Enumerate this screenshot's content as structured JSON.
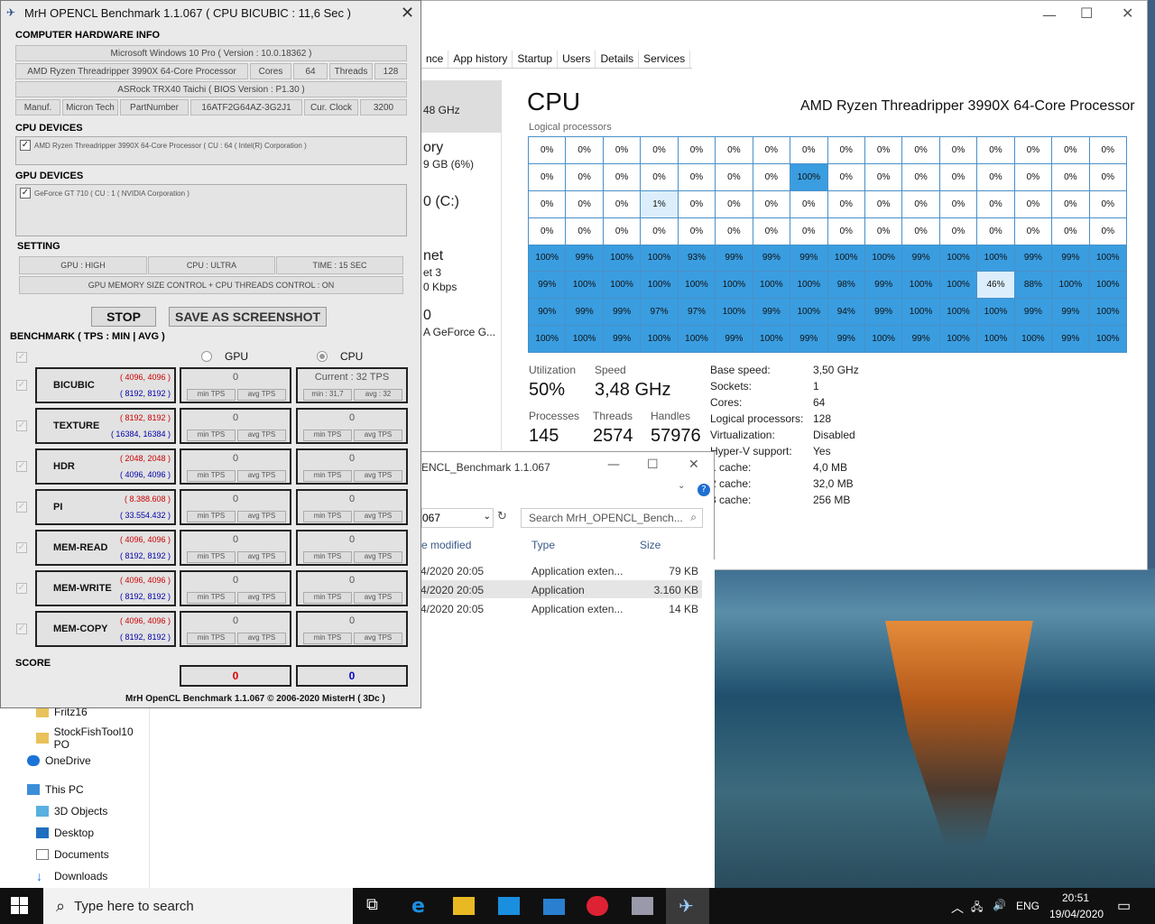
{
  "bench": {
    "title": "MrH OPENCL Benchmark 1.1.067 ( CPU BICUBIC : 11,6 Sec )",
    "hw_section": "COMPUTER HARDWARE INFO",
    "os": "Microsoft Windows 10 Pro ( Version : 10.0.18362 )",
    "cpu_name": "AMD Ryzen Threadripper 3990X 64-Core Processor",
    "cores_label": "Cores",
    "cores": "64",
    "threads_label": "Threads",
    "threads": "128",
    "board": "ASRock TRX40 Taichi ( BIOS Version : P1.30 )",
    "manuf_label": "Manuf.",
    "manuf": "Micron Tech",
    "part_label": "PartNumber",
    "part": "16ATF2G64AZ-3G2J1",
    "clock_label": "Cur. Clock",
    "clock": "3200",
    "cpu_devices": "CPU DEVICES",
    "cpu_device": "AMD Ryzen Threadripper 3990X 64-Core Processor   ( CU : 64  ( Intel(R) Corporation )",
    "gpu_devices": "GPU DEVICES",
    "gpu_device": "GeForce GT 710 ( CU : 1  ( NVIDIA Corporation )",
    "setting": "SETTING",
    "gpu_setting": "GPU : HIGH",
    "cpu_setting": "CPU : ULTRA",
    "time_setting": "TIME : 15 SEC",
    "memory_setting": "GPU MEMORY SIZE CONTROL + CPU THREADS CONTROL : ON",
    "stop": "STOP",
    "screenshot": "SAVE AS SCREENSHOT",
    "benchmark_label": "BENCHMARK ( TPS : MIN | AVG )",
    "gpu_col": "GPU",
    "cpu_col": "CPU",
    "min_tps": "min TPS",
    "avg_tps": "avg TPS",
    "rows": [
      {
        "name": "BICUBIC",
        "red": "( 4096, 4096 )",
        "blue": "( 8192, 8192 )",
        "gpu": "0",
        "cpu": "Current : 32 TPS",
        "cpu_min": "min : 31,7",
        "cpu_avg": "avg : 32"
      },
      {
        "name": "TEXTURE",
        "red": "( 8192, 8192 )",
        "blue": "( 16384, 16384 )",
        "gpu": "0",
        "cpu": "0",
        "cpu_min": "min TPS",
        "cpu_avg": "avg TPS"
      },
      {
        "name": "HDR",
        "red": "( 2048, 2048 )",
        "blue": "( 4096, 4096 )",
        "gpu": "0",
        "cpu": "0",
        "cpu_min": "min TPS",
        "cpu_avg": "avg TPS"
      },
      {
        "name": "PI",
        "red": "( 8.388.608 )",
        "blue": "( 33.554.432 )",
        "gpu": "0",
        "cpu": "0",
        "cpu_min": "min TPS",
        "cpu_avg": "avg TPS"
      },
      {
        "name": "MEM-READ",
        "red": "( 4096, 4096 )",
        "blue": "( 8192, 8192 )",
        "gpu": "0",
        "cpu": "0",
        "cpu_min": "min TPS",
        "cpu_avg": "avg TPS"
      },
      {
        "name": "MEM-WRITE",
        "red": "( 4096, 4096 )",
        "blue": "( 8192, 8192 )",
        "gpu": "0",
        "cpu": "0",
        "cpu_min": "min TPS",
        "cpu_avg": "avg TPS"
      },
      {
        "name": "MEM-COPY",
        "red": "( 4096, 4096 )",
        "blue": "( 8192, 8192 )",
        "gpu": "0",
        "cpu": "0",
        "cpu_min": "min TPS",
        "cpu_avg": "avg TPS"
      }
    ],
    "score_label": "SCORE",
    "gpu_score": "0",
    "cpu_score": "0",
    "footer": "MrH OpenCL Benchmark 1.1.067  ©  2006-2020 MisterH ( 3Dc )"
  },
  "taskmgr": {
    "tabs": [
      "nce",
      "App history",
      "Startup",
      "Users",
      "Details",
      "Services"
    ],
    "side": [
      "48 GHz",
      "ory",
      "9 GB (6%)",
      "0 (C:)",
      "net",
      "et 3",
      "0 Kbps",
      "0",
      "A GeForce G..."
    ],
    "title": "CPU",
    "cpu_name": "AMD Ryzen Threadripper 3990X 64-Core Processor",
    "lp_label": "Logical processors",
    "grid": [
      [
        "0%",
        "0%",
        "0%",
        "0%",
        "0%",
        "0%",
        "0%",
        "0%",
        "0%",
        "0%",
        "0%",
        "0%",
        "0%",
        "0%",
        "0%",
        "0%"
      ],
      [
        "0%",
        "0%",
        "0%",
        "0%",
        "0%",
        "0%",
        "0%",
        "100%",
        "0%",
        "0%",
        "0%",
        "0%",
        "0%",
        "0%",
        "0%",
        "0%"
      ],
      [
        "0%",
        "0%",
        "0%",
        "1%",
        "0%",
        "0%",
        "0%",
        "0%",
        "0%",
        "0%",
        "0%",
        "0%",
        "0%",
        "0%",
        "0%",
        "0%"
      ],
      [
        "0%",
        "0%",
        "0%",
        "0%",
        "0%",
        "0%",
        "0%",
        "0%",
        "0%",
        "0%",
        "0%",
        "0%",
        "0%",
        "0%",
        "0%",
        "0%"
      ],
      [
        "100%",
        "99%",
        "100%",
        "100%",
        "93%",
        "99%",
        "99%",
        "99%",
        "100%",
        "100%",
        "99%",
        "100%",
        "100%",
        "99%",
        "99%",
        "100%"
      ],
      [
        "99%",
        "100%",
        "100%",
        "100%",
        "100%",
        "100%",
        "100%",
        "100%",
        "98%",
        "99%",
        "100%",
        "100%",
        "46%",
        "88%",
        "100%",
        "100%"
      ],
      [
        "90%",
        "99%",
        "99%",
        "97%",
        "97%",
        "100%",
        "99%",
        "100%",
        "94%",
        "99%",
        "100%",
        "100%",
        "100%",
        "99%",
        "99%",
        "100%"
      ],
      [
        "100%",
        "100%",
        "99%",
        "100%",
        "100%",
        "99%",
        "100%",
        "99%",
        "99%",
        "100%",
        "99%",
        "100%",
        "100%",
        "100%",
        "99%",
        "100%"
      ]
    ],
    "util_label": "Utilization",
    "util": "50%",
    "speed_label": "Speed",
    "speed": "3,48 GHz",
    "proc_label": "Processes",
    "proc": "145",
    "threads_label": "Threads",
    "threads": "2574",
    "handles_label": "Handles",
    "handles": "57976",
    "kv": [
      {
        "k": "Base speed:",
        "v": "3,50 GHz"
      },
      {
        "k": "Sockets:",
        "v": "1"
      },
      {
        "k": "Cores:",
        "v": "64"
      },
      {
        "k": "Logical processors:",
        "v": "128"
      },
      {
        "k": "Virtualization:",
        "v": "Disabled"
      },
      {
        "k": "Hyper-V support:",
        "v": "Yes"
      },
      {
        "k": "1 cache:",
        "v": "4,0 MB"
      },
      {
        "k": "2 cache:",
        "v": "32,0 MB"
      },
      {
        "k": "3 cache:",
        "v": "256 MB"
      }
    ]
  },
  "explorer": {
    "title": "ENCL_Benchmark 1.1.067",
    "path": "067",
    "search": "Search MrH_OPENCL_Bench...",
    "col_mod": "e modified",
    "col_type": "Type",
    "col_size": "Size",
    "files": [
      {
        "mod": "4/2020 20:05",
        "type": "Application exten...",
        "size": "79 KB"
      },
      {
        "mod": "4/2020 20:05",
        "type": "Application",
        "size": "3.160 KB"
      },
      {
        "mod": "4/2020 20:05",
        "type": "Application exten...",
        "size": "14 KB"
      }
    ],
    "nav": [
      "Fritz16",
      "StockFishTool10 PO",
      "OneDrive",
      "This PC",
      "3D Objects",
      "Desktop",
      "Documents",
      "Downloads"
    ]
  },
  "taskbar": {
    "search": "Type here to search",
    "lang": "ENG",
    "time": "20:51",
    "date": "19/04/2020"
  }
}
